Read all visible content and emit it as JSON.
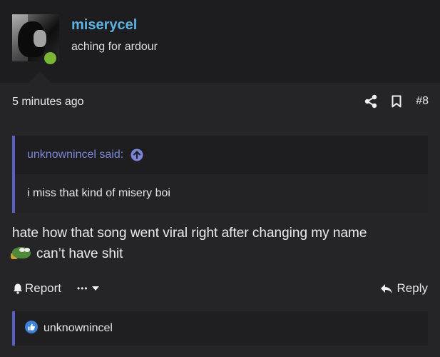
{
  "user": {
    "username": "miserycel",
    "title": "aching for ardour"
  },
  "post": {
    "time": "5 minutes ago",
    "number": "#8",
    "quote": {
      "author": "unknownincel said:",
      "text": "i miss that kind of misery boi"
    },
    "message_line1": "hate how that song went viral right after changing my name",
    "message_line2": "can’t have shit",
    "actions": {
      "report": "Report",
      "more": "•••",
      "reply": "Reply"
    },
    "reactions": {
      "names": "unknownincel"
    }
  },
  "colors": {
    "accent_username": "#5bb2e0",
    "quote_bar": "#5a5fc4",
    "quote_author": "#7c86d8",
    "online": "#7ab534",
    "like": "#3d82d6"
  },
  "icons": [
    "share-icon",
    "bookmark-icon",
    "arrow-up-circle-icon",
    "bell-icon",
    "chevron-down-icon",
    "reply-icon",
    "like-icon"
  ]
}
